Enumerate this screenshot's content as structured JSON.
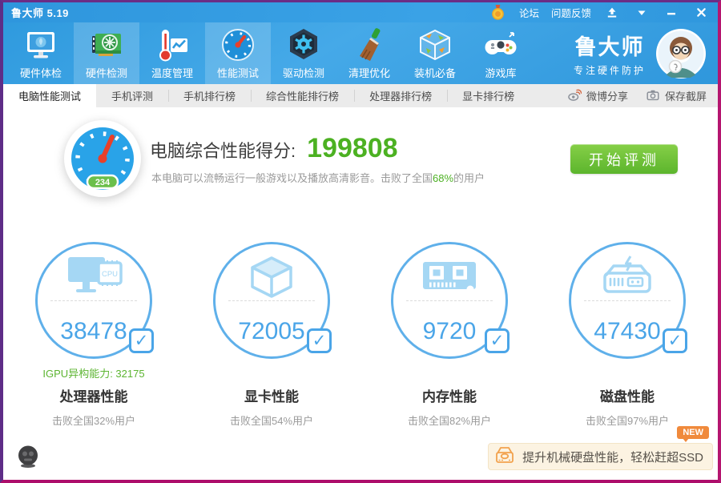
{
  "window": {
    "title": "鲁大师 5.19",
    "menu": {
      "forum": "论坛",
      "feedback": "问题反馈"
    }
  },
  "toolbar": {
    "brand_name": "鲁大师",
    "brand_slogan": "专注硬件防护",
    "items": [
      {
        "label": "硬件体检",
        "icon": "monitor-checkup-icon"
      },
      {
        "label": "硬件检测",
        "icon": "gpu-card-icon"
      },
      {
        "label": "温度管理",
        "icon": "thermometer-icon"
      },
      {
        "label": "性能测试",
        "icon": "speedometer-icon"
      },
      {
        "label": "驱动检测",
        "icon": "gear-hexagon-icon"
      },
      {
        "label": "清理优化",
        "icon": "broom-icon"
      },
      {
        "label": "装机必备",
        "icon": "cube-box-icon"
      },
      {
        "label": "游戏库",
        "icon": "gamepad-icon"
      }
    ]
  },
  "tabs": {
    "items": [
      "电脑性能测试",
      "手机评测",
      "手机排行榜",
      "综合性能排行榜",
      "处理器排行榜",
      "显卡排行榜"
    ],
    "active": "电脑性能测试",
    "share_weibo": "微博分享",
    "save_screenshot": "保存截屏"
  },
  "score": {
    "label": "电脑综合性能得分:",
    "value": "199808",
    "gauge_badge": "234",
    "desc_prefix": "本电脑可以流畅运行一般游戏以及播放高清影音。击败了全国",
    "desc_percent": "68%",
    "desc_suffix": "的用户",
    "start_button": "开始评测"
  },
  "metrics": [
    {
      "name": "处理器性能",
      "score": "38478",
      "extra": "IGPU异构能力: 32175",
      "beat": "击败全国32%用户",
      "icon": "cpu-monitor-icon",
      "icon_text": "CPU"
    },
    {
      "name": "显卡性能",
      "score": "72005",
      "extra": "",
      "beat": "击败全国54%用户",
      "icon": "gpu-cube-icon"
    },
    {
      "name": "内存性能",
      "score": "9720",
      "extra": "",
      "beat": "击败全国82%用户",
      "icon": "ram-icon"
    },
    {
      "name": "磁盘性能",
      "score": "47430",
      "extra": "",
      "beat": "击败全国97%用户",
      "icon": "disk-icon"
    }
  ],
  "footer": {
    "new_badge": "NEW",
    "banner_text": "提升机械硬盘性能，轻松赶超SSD"
  },
  "colors": {
    "header_blue": "#2f9ade",
    "score_green": "#4cb122",
    "circle_blue": "#5fb0ea",
    "button_green": "#5cb52d",
    "badge_orange": "#f08a3c"
  }
}
